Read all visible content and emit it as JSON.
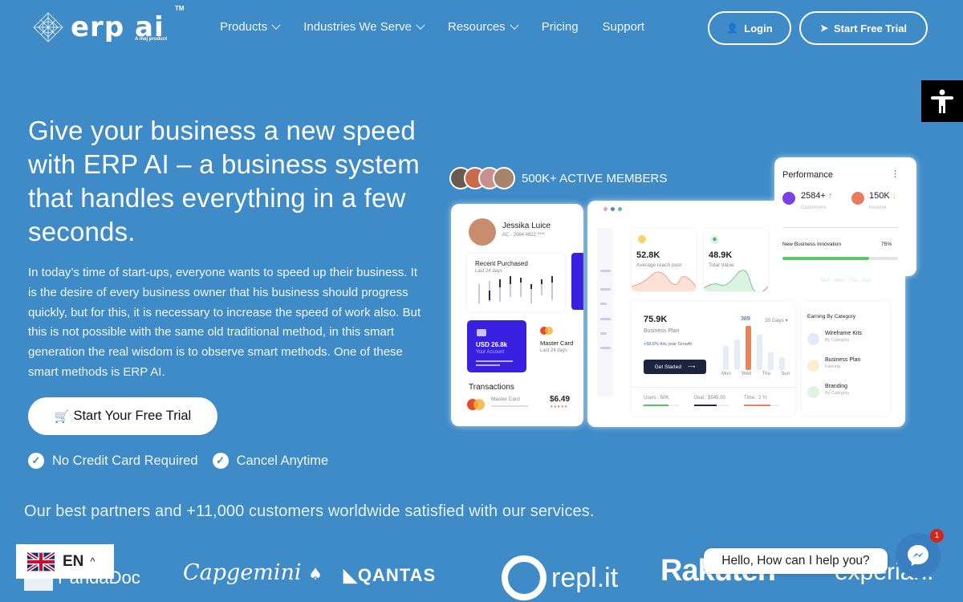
{
  "brand": {
    "name": "erp ai",
    "tm": "TM",
    "tagline": "A mej product"
  },
  "nav": {
    "items": [
      {
        "label": "Products",
        "dropdown": true
      },
      {
        "label": "Industries We Serve",
        "dropdown": true
      },
      {
        "label": "Resources",
        "dropdown": true
      },
      {
        "label": "Pricing",
        "dropdown": false
      },
      {
        "label": "Support",
        "dropdown": false
      }
    ],
    "login_label": "Login",
    "trial_label": "Start Free Trial"
  },
  "hero": {
    "title": "Give your business a new speed with ERP AI – a business system that handles everything in a few seconds.",
    "description": "In today’s time of start-ups, everyone wants to speed up their business. It is the desire of every business owner that his business should progress quickly, but for this, it is necessary to increase the speed of work also. But this is not possible with the same old traditional method, in this smart generation the real wisdom is to observe smart methods. One of these smart methods is ERP AI.",
    "cta_label": "Start Your Free Trial",
    "checks": [
      "No Credit Card Required",
      "Cancel Anytime"
    ]
  },
  "dashboard": {
    "members_label": "500K+ ACTIVE MEMBERS",
    "profile": {
      "name": "Jessika Luice",
      "account": "AC - 2064 4822 ****"
    },
    "recent": {
      "title": "Recent Purchased",
      "subtitle": "Last 24 days"
    },
    "account_card": {
      "amount": "USD 26.8k",
      "label": "Your Account"
    },
    "mastercard": {
      "title": "Master Card",
      "subtitle": "Last 24 days"
    },
    "transactions": {
      "title": "Transactions",
      "item": "Master Card",
      "amount": "$6.49",
      "stars": "★★★★★"
    },
    "stat1": {
      "value": "52.8K",
      "label": "Average reach post"
    },
    "stat2": {
      "value": "48.9K",
      "label": "Total Value"
    },
    "plan": {
      "value": "75.9K",
      "label": "Business Plan",
      "growth_pct": "+58.6%",
      "growth_text": "this year Growth",
      "button": "Get Started",
      "peak": "389",
      "range": "30 Days",
      "days": [
        "Mon",
        "Wed",
        "Thu",
        "Sun"
      ],
      "bars": [
        0.55,
        0.7,
        1.0,
        0.8,
        0.4,
        0.3
      ]
    },
    "footer_stats": [
      {
        "label": "Users : 50K",
        "fill": 0.7,
        "color": "#4cc36a"
      },
      {
        "label": "Goal : $545.00",
        "fill": 0.65,
        "color": "#1d2a52"
      },
      {
        "label": "Time : 2 Yr",
        "fill": 0.75,
        "color": "#e8845c"
      }
    ],
    "earning": {
      "title": "Earning By Category",
      "items": [
        {
          "title": "Wireframe Kits",
          "subtitle": "By Category",
          "color": "#e3e9f8"
        },
        {
          "title": "Business Plan",
          "subtitle": "Earning",
          "color": "#fbefcf"
        },
        {
          "title": "Branding",
          "subtitle": "By Category",
          "color": "#dff3e3"
        }
      ]
    },
    "performance": {
      "title": "Performance",
      "customers": {
        "value": "2584+",
        "label": "Customers"
      },
      "income": {
        "value": "150K",
        "label": "Income"
      },
      "progress": {
        "label": "New Business Innovation",
        "value_text": "75%",
        "fraction": 0.75
      }
    },
    "hidden_days": [
      "Mon",
      "Wed",
      "Thu",
      "Sun"
    ]
  },
  "partners": {
    "line": "Our best partners and +11,000 customers worldwide satisfied with our services.",
    "logos": [
      "PandaDoc",
      "Capgemini",
      "QANTAS",
      "repl.it",
      "Rakuten",
      "experian."
    ]
  },
  "language": {
    "code": "EN"
  },
  "chat": {
    "greeting": "Hello, How can I help you?",
    "badge": "1"
  }
}
